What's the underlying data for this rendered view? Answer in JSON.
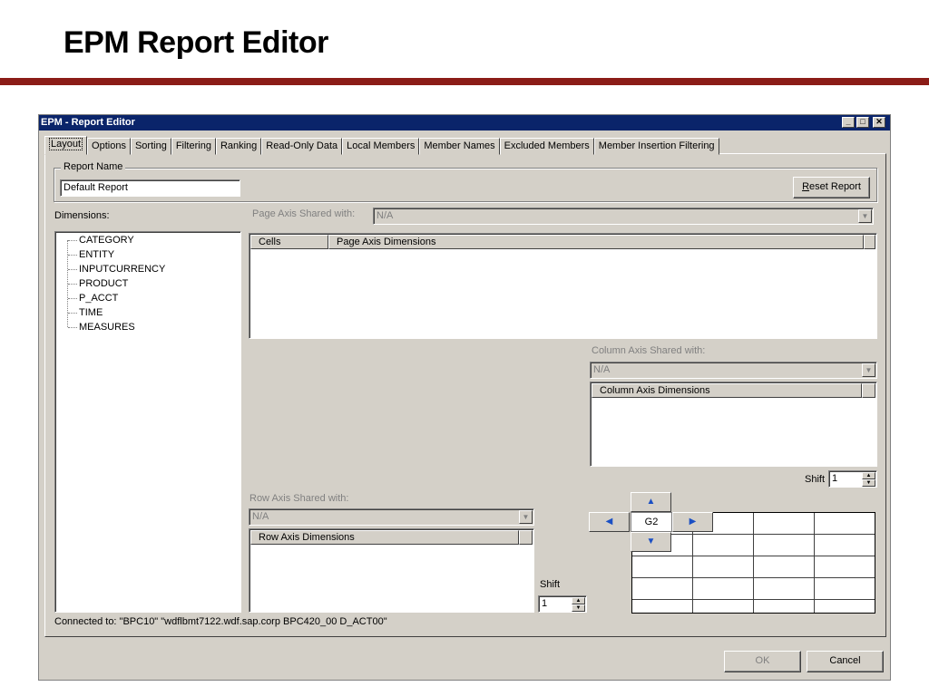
{
  "slide": {
    "title": "EPM Report Editor"
  },
  "window": {
    "title": "EPM - Report Editor",
    "controls": [
      "minimize-icon",
      "maximize-icon",
      "close-icon"
    ],
    "controls_glyphs": {
      "minimize": "_",
      "maximize": "□",
      "close": "✕"
    }
  },
  "tabs": [
    {
      "label": "Layout",
      "active": true
    },
    {
      "label": "Options"
    },
    {
      "label": "Sorting"
    },
    {
      "label": "Filtering"
    },
    {
      "label": "Ranking"
    },
    {
      "label": "Read-Only Data"
    },
    {
      "label": "Local Members"
    },
    {
      "label": "Member Names"
    },
    {
      "label": "Excluded Members"
    },
    {
      "label": "Member Insertion Filtering"
    }
  ],
  "report_name": {
    "legend": "Report Name",
    "value": "Default Report"
  },
  "reset_button": {
    "prefix": "",
    "accel": "R",
    "rest": "eset Report"
  },
  "dimensions": {
    "label": "Dimensions:",
    "items": [
      "CATEGORY",
      "ENTITY",
      "INPUTCURRENCY",
      "PRODUCT",
      "P_ACCT",
      "TIME",
      "MEASURES"
    ]
  },
  "page_axis": {
    "shared_label": "Page Axis Shared with:",
    "shared_value": "N/A",
    "columns": [
      "Cells",
      "Page Axis Dimensions"
    ]
  },
  "column_axis": {
    "shared_label": "Column Axis Shared with:",
    "shared_value": "N/A",
    "header": "Column Axis Dimensions",
    "shift_label": "Shift",
    "shift_value": "1"
  },
  "row_axis": {
    "shared_label": "Row Axis Shared with:",
    "shared_value": "N/A",
    "header": "Row Axis Dimensions",
    "shift_label": "Shift",
    "shift_value": "1"
  },
  "cell_nav": {
    "current_cell": "G2",
    "up_icon": "arrow-up-icon",
    "down_icon": "arrow-down-icon",
    "left_icon": "arrow-left-icon",
    "right_icon": "arrow-right-icon"
  },
  "status": {
    "connected": "Connected to: \"BPC10\" \"wdflbmt7122.wdf.sap.corp BPC420_00 D_ACT00\""
  },
  "footer": {
    "ok": "OK",
    "cancel": "Cancel"
  },
  "colors": {
    "title_bar": "#0a246a",
    "window_bg": "#d4d0c8",
    "slide_rule": "#8b1c17"
  }
}
